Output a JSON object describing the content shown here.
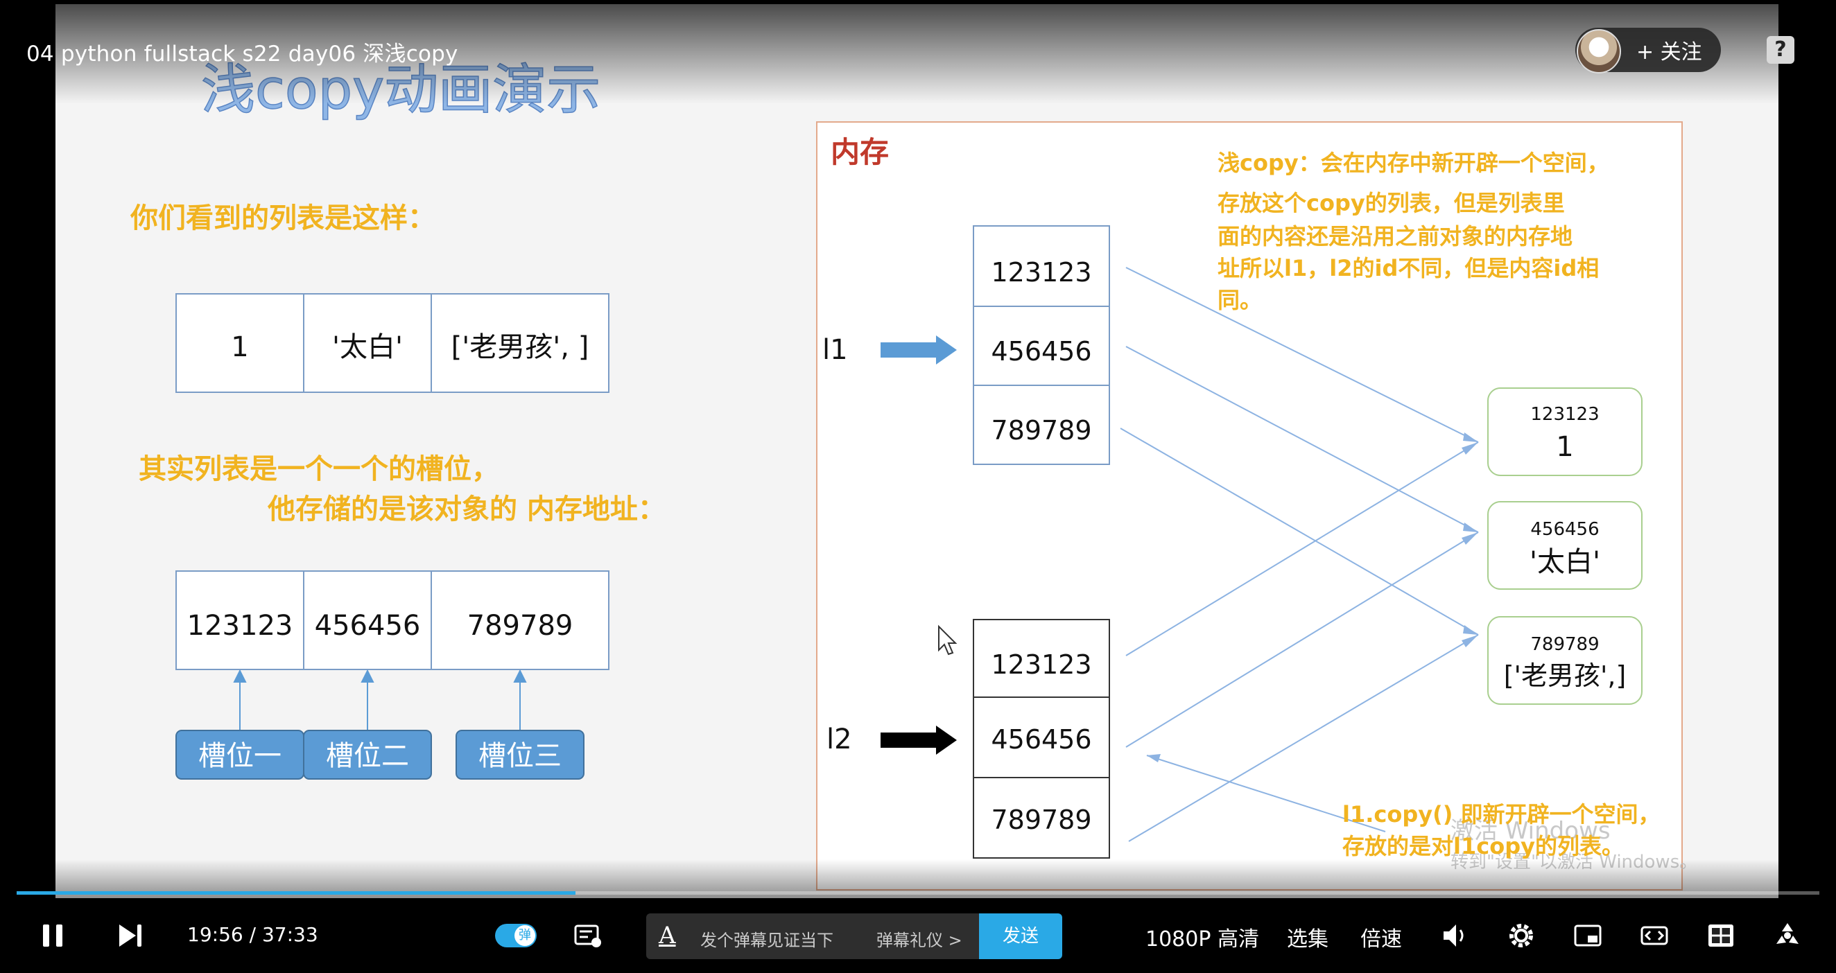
{
  "video": {
    "title": "04 python fullstack s22 day06 深浅copy",
    "follow_label": "+ 关注",
    "progress": 0.31
  },
  "slide": {
    "title": "浅copy动画演示",
    "left": {
      "caption1": "你们看到的列表是这样：",
      "list_cells": [
        "1",
        "'太白'",
        "['老男孩', ]"
      ],
      "caption2_line1": "其实列表是一个一个的槽位，",
      "caption2_line2": "他存储的是该对象的 内存地址：",
      "address_cells": [
        "123123",
        "456456",
        "789789"
      ],
      "slot_labels": [
        "槽位一",
        "槽位二",
        "槽位三"
      ]
    },
    "memory": {
      "header": "内存",
      "note_lines": [
        "浅copy：会在内存中新开辟一个空间，",
        "存放这个copy的列表，但是列表里",
        "面的内容还是沿用之前对象的内存地",
        "址所以l1，l2的id不同，但是内容id相",
        "同。"
      ],
      "l1_label": "l1",
      "l2_label": "l2",
      "l1_cells": [
        "123123",
        "456456",
        "789789"
      ],
      "l2_cells": [
        "123123",
        "456456",
        "789789"
      ],
      "objects": [
        {
          "address": "123123",
          "value": "1"
        },
        {
          "address": "456456",
          "value": "'太白'"
        },
        {
          "address": "789789",
          "value": "['老男孩',]"
        }
      ],
      "bottom_note_line1": "l1.copy() 即新开辟一个空间，",
      "bottom_note_line2": "存放的是对l1copy的列表。",
      "watermark_line1": "激活 Windows",
      "watermark_line2": "转到\"设置\"以激活 Windows。"
    }
  },
  "controls": {
    "current_time": "19:56",
    "total_time": "37:33",
    "danmaku_toggle_glyph": "弹",
    "danmaku_placeholder": "发个弹幕见证当下",
    "danmaku_etiquette": "弹幕礼仪 >",
    "send_label": "发送",
    "quality_label": "1080P 高清",
    "episodes_label": "选集",
    "speed_label": "倍速"
  },
  "colors": {
    "accent": "#2aa9e6",
    "slide_yellow": "#f1b320",
    "slide_red": "#c0392b",
    "arrow_blue": "#5b9bd5",
    "box_border": "#7a9cc6",
    "object_border": "#a9cf8f"
  }
}
